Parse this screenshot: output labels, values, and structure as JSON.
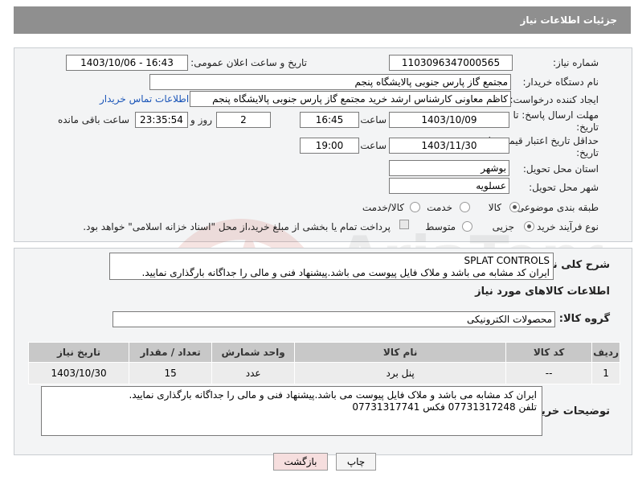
{
  "header": {
    "title": "جزئیات اطلاعات نیاز"
  },
  "form": {
    "need_number_label": "شماره نیاز:",
    "need_number": "1103096347000565",
    "announce_label": "تاریخ و ساعت اعلان عمومی:",
    "announce_value": "1403/10/06 - 16:43",
    "buyer_org_label": "نام دستگاه خریدار:",
    "buyer_org": "مجتمع گاز پارس جنوبی  پالایشگاه پنجم",
    "requester_label": "ایجاد کننده درخواست:",
    "requester": "کاظم معاونی کارشناس ارشد خرید مجتمع گاز پارس جنوبی  پالایشگاه پنجم",
    "contact_link": "اطلاعات تماس خریدار",
    "deadline_label_1": "مهلت ارسال پاسخ: تا",
    "deadline_label_2": "تاریخ:",
    "deadline_date": "1403/10/09",
    "time_label": "ساعت",
    "deadline_time": "16:45",
    "days_value": "2",
    "days_label": "روز و",
    "remaining_time": "23:35:54",
    "remaining_label": "ساعت باقی مانده",
    "price_label_1": "حداقل تاریخ اعتبار قیمت: تا",
    "price_label_2": "تاریخ:",
    "price_date": "1403/11/30",
    "price_time_label": "ساعت",
    "price_time": "19:00",
    "province_label": "استان محل تحویل:",
    "province": "بوشهر",
    "city_label": "شهر محل تحویل:",
    "city": "عسلویه",
    "category_label": "طبقه بندی موضوعی:",
    "category_options": [
      "کالا",
      "خدمت",
      "کالا/خدمت"
    ],
    "category_selected": "کالا",
    "purchase_type_label": "نوع فرآیند خرید :",
    "purchase_options": [
      "جزیی",
      "متوسط"
    ],
    "purchase_selected": "جزیی",
    "payment_note": "پرداخت تمام یا بخشی از مبلغ خرید،از محل \"اسناد خزانه اسلامی\" خواهد بود."
  },
  "details": {
    "general_desc_label": "شرح کلی نیاز:",
    "general_desc_line1": "SPLAT CONTROLS",
    "general_desc_line2": "ایران کد مشابه می باشد و ملاک فایل پیوست می باشد.پیشنهاد فنی و مالی را جداگانه بارگذاری نمایید.",
    "goods_info_title": "اطلاعات کالاهای مورد نیاز",
    "goods_group_label": "گروه کالا:",
    "goods_group": "محصولات الکترونیکی"
  },
  "table": {
    "headers": [
      "ردیف",
      "کد کالا",
      "نام کالا",
      "واحد شمارش",
      "تعداد / مقدار",
      "تاریخ نیاز"
    ],
    "rows": [
      [
        "1",
        "--",
        "پنل برد",
        "عدد",
        "15",
        "1403/10/30"
      ]
    ]
  },
  "buyer_notes": {
    "label": "توضیحات خریدار:",
    "line1": "ایران کد مشابه می باشد و ملاک فایل پیوست می باشد.پیشنهاد فنی و مالی را جداگانه بارگذاری نمایید.",
    "line2": "تلفن 07731317248  فکس 07731317741"
  },
  "buttons": {
    "print": "چاپ",
    "back": "بازگشت"
  },
  "colors": {
    "header_bg": "#8f8f8f",
    "link": "#1a55b8",
    "back_btn_bg": "#f6dede"
  }
}
